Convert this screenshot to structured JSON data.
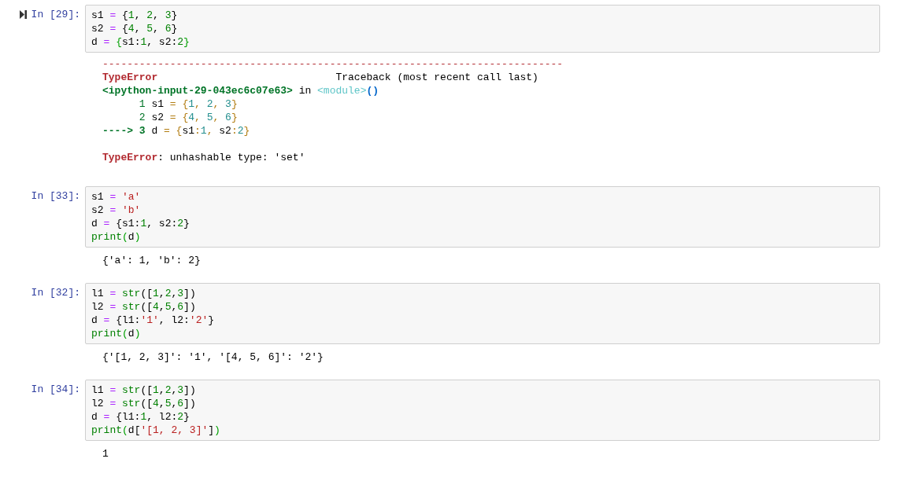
{
  "cells": [
    {
      "prompt": "In [29]:",
      "selected": true,
      "input": [
        [
          {
            "kind": "t",
            "text": "s1"
          },
          {
            "kind": "op",
            "text": " = "
          },
          {
            "kind": "t",
            "text": "{"
          },
          {
            "kind": "num",
            "text": "1"
          },
          {
            "kind": "t",
            "text": ", "
          },
          {
            "kind": "num",
            "text": "2"
          },
          {
            "kind": "t",
            "text": ", "
          },
          {
            "kind": "num",
            "text": "3"
          },
          {
            "kind": "t",
            "text": "}"
          }
        ],
        [
          {
            "kind": "t",
            "text": "s2"
          },
          {
            "kind": "op",
            "text": " = "
          },
          {
            "kind": "t",
            "text": "{"
          },
          {
            "kind": "num",
            "text": "4"
          },
          {
            "kind": "t",
            "text": ", "
          },
          {
            "kind": "num",
            "text": "5"
          },
          {
            "kind": "t",
            "text": ", "
          },
          {
            "kind": "num",
            "text": "6"
          },
          {
            "kind": "t",
            "text": "}"
          }
        ],
        [
          {
            "kind": "t",
            "text": "d"
          },
          {
            "kind": "op",
            "text": " = "
          },
          {
            "kind": "mb",
            "text": "{"
          },
          {
            "kind": "t",
            "text": "s1:"
          },
          {
            "kind": "num",
            "text": "1"
          },
          {
            "kind": "t",
            "text": ", s2:"
          },
          {
            "kind": "num",
            "text": "2"
          },
          {
            "kind": "mb",
            "text": "}"
          }
        ]
      ],
      "output": {
        "kind": "error",
        "traceback": [
          [
            {
              "kind": "red",
              "text": "---------------------------------------------------------------------------"
            }
          ],
          [
            {
              "kind": "err",
              "text": "TypeError"
            },
            {
              "kind": "t",
              "text": "                             Traceback (most recent call last)"
            }
          ],
          [
            {
              "kind": "tbf",
              "text": "<ipython-input-29-043ec6c07e63>"
            },
            {
              "kind": "t",
              "text": " in "
            },
            {
              "kind": "mod",
              "text": "<module>"
            },
            {
              "kind": "par",
              "text": "()"
            }
          ],
          [
            {
              "kind": "ln",
              "text": "      1"
            },
            {
              "kind": "t",
              "text": " s1 "
            },
            {
              "kind": "ty",
              "text": "= {"
            },
            {
              "kind": "tn",
              "text": "1"
            },
            {
              "kind": "ty",
              "text": ", "
            },
            {
              "kind": "tn",
              "text": "2"
            },
            {
              "kind": "ty",
              "text": ", "
            },
            {
              "kind": "tn",
              "text": "3"
            },
            {
              "kind": "ty",
              "text": "}"
            }
          ],
          [
            {
              "kind": "ln",
              "text": "      2"
            },
            {
              "kind": "t",
              "text": " s2 "
            },
            {
              "kind": "ty",
              "text": "= {"
            },
            {
              "kind": "tn",
              "text": "4"
            },
            {
              "kind": "ty",
              "text": ", "
            },
            {
              "kind": "tn",
              "text": "5"
            },
            {
              "kind": "ty",
              "text": ", "
            },
            {
              "kind": "tn",
              "text": "6"
            },
            {
              "kind": "ty",
              "text": "}"
            }
          ],
          [
            {
              "kind": "arr",
              "text": "----> 3"
            },
            {
              "kind": "t",
              "text": " d "
            },
            {
              "kind": "ty",
              "text": "= {"
            },
            {
              "kind": "t",
              "text": "s1"
            },
            {
              "kind": "ty",
              "text": ":"
            },
            {
              "kind": "tn",
              "text": "1"
            },
            {
              "kind": "ty",
              "text": ", "
            },
            {
              "kind": "t",
              "text": "s2"
            },
            {
              "kind": "ty",
              "text": ":"
            },
            {
              "kind": "tn",
              "text": "2"
            },
            {
              "kind": "ty",
              "text": "}"
            }
          ]
        ],
        "message": [
          {
            "kind": "err",
            "text": "TypeError"
          },
          {
            "kind": "t",
            "text": ": unhashable type: 'set'"
          }
        ]
      }
    },
    {
      "prompt": "In [33]:",
      "selected": false,
      "input": [
        [
          {
            "kind": "t",
            "text": "s1"
          },
          {
            "kind": "op",
            "text": " = "
          },
          {
            "kind": "str",
            "text": "'a'"
          }
        ],
        [
          {
            "kind": "t",
            "text": "s2"
          },
          {
            "kind": "op",
            "text": " = "
          },
          {
            "kind": "str",
            "text": "'b'"
          }
        ],
        [
          {
            "kind": "t",
            "text": "d"
          },
          {
            "kind": "op",
            "text": " = "
          },
          {
            "kind": "t",
            "text": "{s1:"
          },
          {
            "kind": "num",
            "text": "1"
          },
          {
            "kind": "t",
            "text": ", s2:"
          },
          {
            "kind": "num",
            "text": "2"
          },
          {
            "kind": "t",
            "text": "}"
          }
        ],
        [
          {
            "kind": "bi",
            "text": "print"
          },
          {
            "kind": "mb",
            "text": "("
          },
          {
            "kind": "t",
            "text": "d"
          },
          {
            "kind": "mb",
            "text": ")"
          }
        ]
      ],
      "output": {
        "kind": "stream",
        "lines": [
          "{'a': 1, 'b': 2}"
        ]
      }
    },
    {
      "prompt": "In [32]:",
      "selected": false,
      "input": [
        [
          {
            "kind": "t",
            "text": "l1"
          },
          {
            "kind": "op",
            "text": " = "
          },
          {
            "kind": "bi",
            "text": "str"
          },
          {
            "kind": "t",
            "text": "(["
          },
          {
            "kind": "num",
            "text": "1"
          },
          {
            "kind": "t",
            "text": ","
          },
          {
            "kind": "num",
            "text": "2"
          },
          {
            "kind": "t",
            "text": ","
          },
          {
            "kind": "num",
            "text": "3"
          },
          {
            "kind": "t",
            "text": "])"
          }
        ],
        [
          {
            "kind": "t",
            "text": "l2"
          },
          {
            "kind": "op",
            "text": " = "
          },
          {
            "kind": "bi",
            "text": "str"
          },
          {
            "kind": "t",
            "text": "(["
          },
          {
            "kind": "num",
            "text": "4"
          },
          {
            "kind": "t",
            "text": ","
          },
          {
            "kind": "num",
            "text": "5"
          },
          {
            "kind": "t",
            "text": ","
          },
          {
            "kind": "num",
            "text": "6"
          },
          {
            "kind": "t",
            "text": "])"
          }
        ],
        [
          {
            "kind": "t",
            "text": "d"
          },
          {
            "kind": "op",
            "text": " = "
          },
          {
            "kind": "t",
            "text": "{l1:"
          },
          {
            "kind": "str",
            "text": "'1'"
          },
          {
            "kind": "t",
            "text": ", l2:"
          },
          {
            "kind": "str",
            "text": "'2'"
          },
          {
            "kind": "t",
            "text": "}"
          }
        ],
        [
          {
            "kind": "bi",
            "text": "print"
          },
          {
            "kind": "mb",
            "text": "("
          },
          {
            "kind": "t",
            "text": "d"
          },
          {
            "kind": "mb",
            "text": ")"
          }
        ]
      ],
      "output": {
        "kind": "stream",
        "lines": [
          "{'[1, 2, 3]': '1', '[4, 5, 6]': '2'}"
        ]
      }
    },
    {
      "prompt": "In [34]:",
      "selected": false,
      "input": [
        [
          {
            "kind": "t",
            "text": "l1"
          },
          {
            "kind": "op",
            "text": " = "
          },
          {
            "kind": "bi",
            "text": "str"
          },
          {
            "kind": "t",
            "text": "(["
          },
          {
            "kind": "num",
            "text": "1"
          },
          {
            "kind": "t",
            "text": ","
          },
          {
            "kind": "num",
            "text": "2"
          },
          {
            "kind": "t",
            "text": ","
          },
          {
            "kind": "num",
            "text": "3"
          },
          {
            "kind": "t",
            "text": "])"
          }
        ],
        [
          {
            "kind": "t",
            "text": "l2"
          },
          {
            "kind": "op",
            "text": " = "
          },
          {
            "kind": "bi",
            "text": "str"
          },
          {
            "kind": "t",
            "text": "(["
          },
          {
            "kind": "num",
            "text": "4"
          },
          {
            "kind": "t",
            "text": ","
          },
          {
            "kind": "num",
            "text": "5"
          },
          {
            "kind": "t",
            "text": ","
          },
          {
            "kind": "num",
            "text": "6"
          },
          {
            "kind": "t",
            "text": "])"
          }
        ],
        [
          {
            "kind": "t",
            "text": "d"
          },
          {
            "kind": "op",
            "text": " = "
          },
          {
            "kind": "t",
            "text": "{l1:"
          },
          {
            "kind": "num",
            "text": "1"
          },
          {
            "kind": "t",
            "text": ", l2:"
          },
          {
            "kind": "num",
            "text": "2"
          },
          {
            "kind": "t",
            "text": "}"
          }
        ],
        [
          {
            "kind": "bi",
            "text": "print"
          },
          {
            "kind": "mb",
            "text": "("
          },
          {
            "kind": "t",
            "text": "d["
          },
          {
            "kind": "str",
            "text": "'[1, 2, 3]'"
          },
          {
            "kind": "t",
            "text": "]"
          },
          {
            "kind": "mb",
            "text": ")"
          }
        ]
      ],
      "output": {
        "kind": "stream",
        "lines": [
          "1"
        ]
      }
    }
  ]
}
